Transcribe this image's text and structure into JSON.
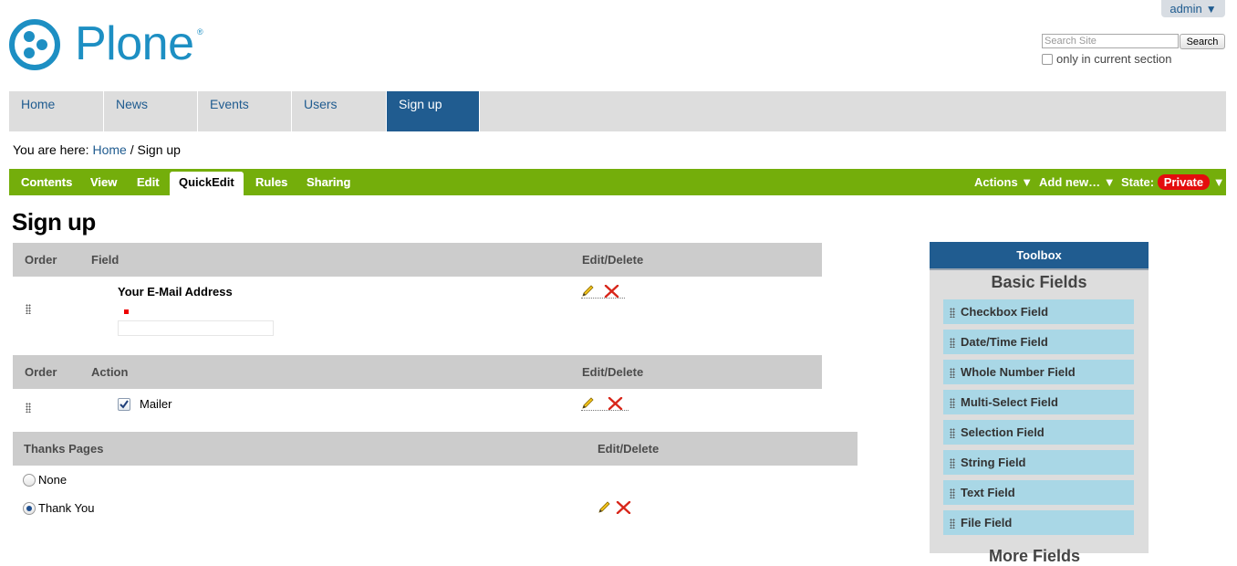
{
  "user_menu": {
    "label": "admin",
    "arrow": "▼"
  },
  "logo": {
    "text": "Plone",
    "reg": "®"
  },
  "search": {
    "placeholder": "Search Site",
    "button_label": "Search",
    "scope_label": "only in current section"
  },
  "global_nav": {
    "items": [
      {
        "label": "Home"
      },
      {
        "label": "News"
      },
      {
        "label": "Events"
      },
      {
        "label": "Users"
      },
      {
        "label": "Sign up"
      }
    ],
    "active": "Sign up"
  },
  "breadcrumb": {
    "prefix": "You are here:",
    "home": "Home",
    "separator": "/",
    "current": "Sign up"
  },
  "edit_bar": {
    "tabs": [
      {
        "label": "Contents"
      },
      {
        "label": "View"
      },
      {
        "label": "Edit"
      },
      {
        "label": "QuickEdit"
      },
      {
        "label": "Rules"
      },
      {
        "label": "Sharing"
      }
    ],
    "active_tab": "QuickEdit",
    "menus": {
      "actions": "Actions ▼",
      "add_new": "Add new… ▼",
      "state_label": "State:",
      "state_value": "Private",
      "state_arrow": "▼"
    },
    "colors": {
      "bar": "#74ae0b",
      "state": "#e40d0d"
    }
  },
  "page_title": "Sign up",
  "fields_table": {
    "headers": {
      "order": "Order",
      "field": "Field",
      "edit_delete": "Edit/Delete"
    },
    "rows": [
      {
        "label": "Your E-Mail Address",
        "required": true
      }
    ]
  },
  "actions_table": {
    "headers": {
      "order": "Order",
      "action": "Action",
      "edit_delete": "Edit/Delete"
    },
    "rows": [
      {
        "label": "Mailer",
        "checked": true
      }
    ]
  },
  "thanks_table": {
    "headers": {
      "thanks": "Thanks Pages",
      "edit_delete": "Edit/Delete"
    },
    "rows": [
      {
        "label": "None",
        "selected": false
      },
      {
        "label": "Thank You",
        "selected": true
      }
    ]
  },
  "toolbox": {
    "title": "Toolbox",
    "subtitle": "Basic Fields",
    "items": [
      {
        "label": "Checkbox Field"
      },
      {
        "label": "Date/Time Field"
      },
      {
        "label": "Whole Number Field"
      },
      {
        "label": "Multi-Select Field"
      },
      {
        "label": "Selection Field"
      },
      {
        "label": "String Field"
      },
      {
        "label": "Text Field"
      },
      {
        "label": "File Field"
      }
    ],
    "more_subtitle": "More Fields",
    "colors": {
      "header": "#205c90",
      "item": "#a9d7e6"
    }
  }
}
